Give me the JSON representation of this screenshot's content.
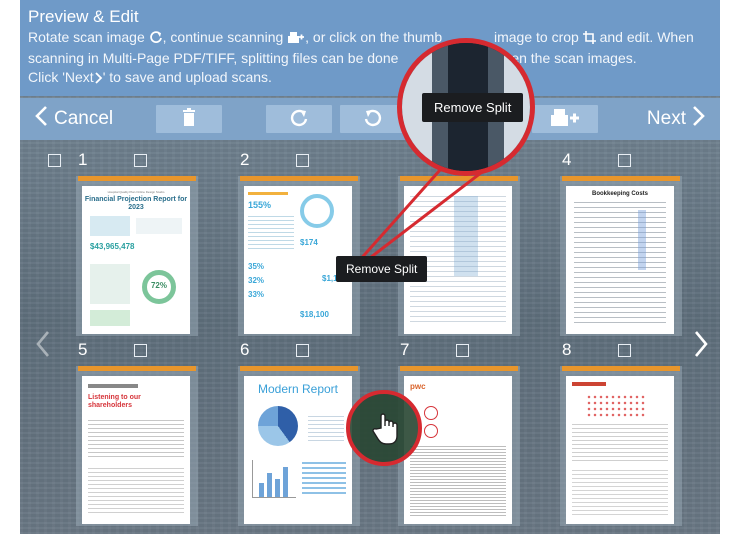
{
  "header": {
    "title": "Preview & Edit",
    "line1_a": "Rotate scan image",
    "line1_b": ", continue scanning",
    "line1_c": ", or click on the thumb",
    "line1_d": "image to crop",
    "line1_e": "and edit.  When",
    "line2_a": "scanning in Multi-Page PDF/TIFF, splitting files can be done",
    "line2_b": "g between the scan images.",
    "line3": "Click 'Next",
    "line3_b": "' to save and upload scans."
  },
  "toolbar": {
    "cancel_label": "Cancel",
    "next_label": "Next"
  },
  "tooltips": {
    "zoom_remove_split": "Remove Split",
    "remove_split": "Remove Split"
  },
  "thumbnails": [
    {
      "number": "1",
      "title": "Financial Projection Report for 2023",
      "subtitle": "Hospital Quality Plan Online Design Studio",
      "stat": "$43,965,478",
      "percent": "72%"
    },
    {
      "number": "2",
      "stat_a": "155%",
      "stat_b": "$174",
      "stat_c": "35%",
      "stat_d": "32%",
      "stat_e": "33%",
      "stat_f": "$1,17",
      "stat_g": "$18,100"
    },
    {
      "number": "3"
    },
    {
      "number": "4",
      "title": "Bookkeeping Costs"
    },
    {
      "number": "5",
      "title": "Listening to our shareholders"
    },
    {
      "number": "6",
      "title": "Modern Report"
    },
    {
      "number": "7",
      "logo": "pwc"
    },
    {
      "number": "8"
    }
  ],
  "colors": {
    "header_bg": "#6f9ac8",
    "toolbar_bg": "#7fa3c8",
    "accent_orange": "#e8962c",
    "highlight_red": "#d62a30"
  },
  "icons": {
    "rotate": "rotate-icon",
    "scan": "scanner-plus-icon",
    "crop": "crop-icon",
    "delete": "trash-icon",
    "hand": "hand-pointer-icon"
  }
}
